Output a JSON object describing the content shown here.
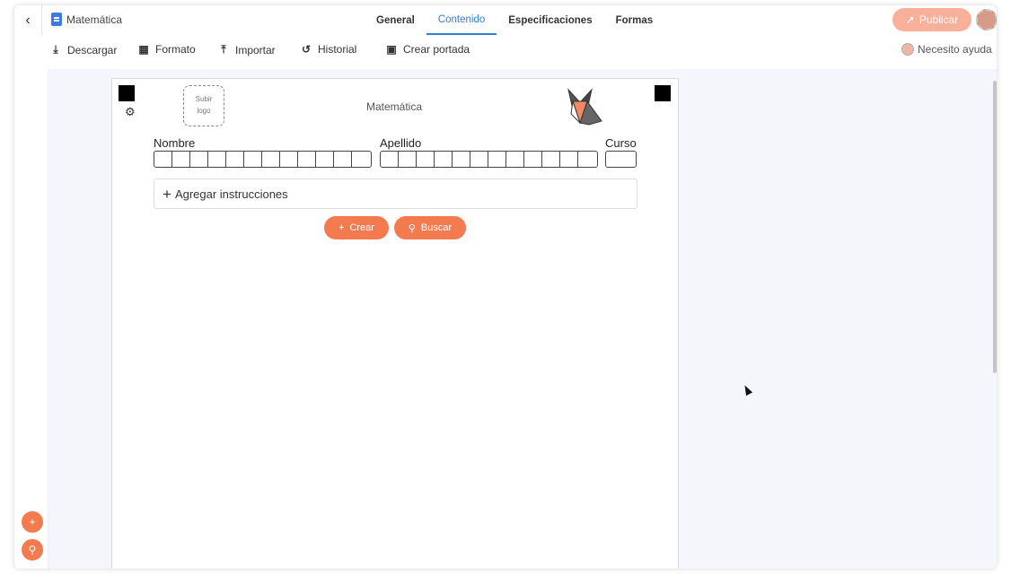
{
  "header": {
    "back_icon": "chevron-left-icon",
    "doc_icon": "document-icon",
    "doc_title": "Matemática",
    "tabs": [
      {
        "label": "General",
        "active": false
      },
      {
        "label": "Contenido",
        "active": true
      },
      {
        "label": "Especificaciones",
        "active": false
      },
      {
        "label": "Formas",
        "active": false
      }
    ],
    "publish_label": "Publicar",
    "publish_icon": "rocket-icon"
  },
  "toolbar": {
    "download_label": "Descargar",
    "format_label": "Formato",
    "import_label": "Importar",
    "history_label": "Historial",
    "cover_label": "Crear portada",
    "help_label": "Necesito ayuda"
  },
  "page": {
    "logo_line1": "Subir",
    "logo_line2": "logo",
    "title": "Matemática",
    "name_label": "Nombre",
    "lastname_label": "Apellido",
    "course_label": "Curso",
    "instructions_label": "Agregar instrucciones",
    "create_label": "Crear",
    "search_label": "Buscar"
  },
  "colors": {
    "accent": "#f47a4f",
    "tab_active": "#2f7fd6",
    "publish_bg": "#f8b09a",
    "workspace_bg": "#f5f6fb"
  }
}
